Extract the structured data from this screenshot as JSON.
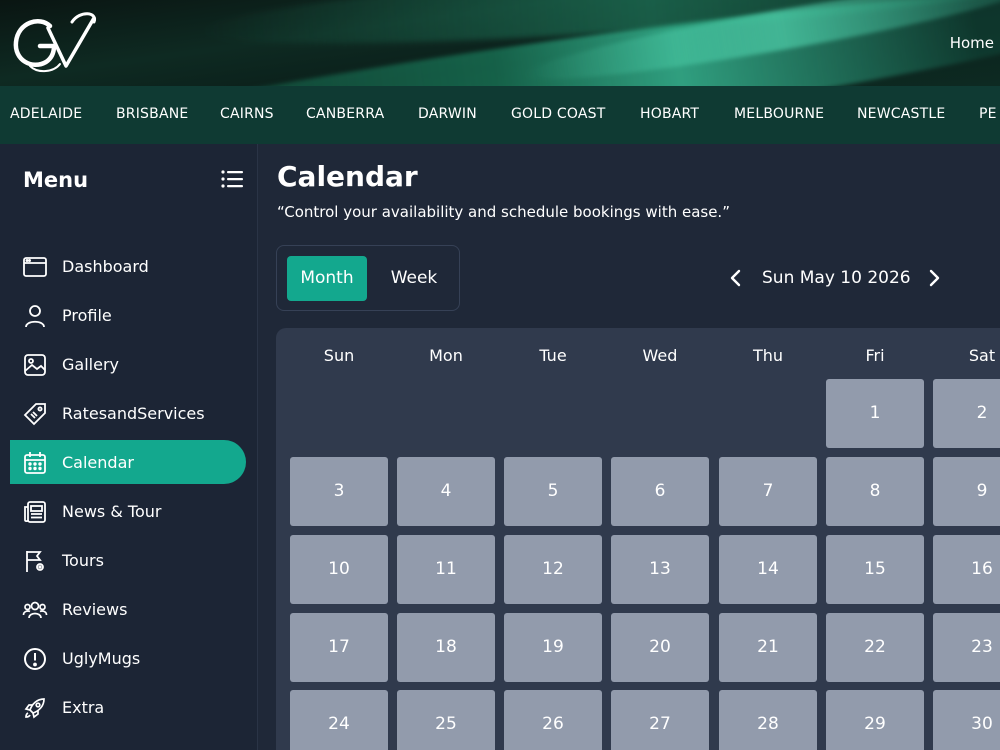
{
  "header": {
    "logo_text": "GV",
    "home_link": "Home"
  },
  "cities": [
    "ADELAIDE",
    "BRISBANE",
    "CAIRNS",
    "CANBERRA",
    "DARWIN",
    "GOLD COAST",
    "HOBART",
    "MELBOURNE",
    "NEWCASTLE",
    "PE"
  ],
  "sidebar": {
    "title": "Menu",
    "toggle_icon": "list-icon",
    "items": [
      {
        "label": "Dashboard",
        "icon": "dashboard-icon",
        "active": false
      },
      {
        "label": "Profile",
        "icon": "user-icon",
        "active": false
      },
      {
        "label": "Gallery",
        "icon": "image-icon",
        "active": false
      },
      {
        "label": "RatesandServices",
        "icon": "tag-icon",
        "active": false
      },
      {
        "label": "Calendar",
        "icon": "calendar-icon",
        "active": true
      },
      {
        "label": "News & Tour",
        "icon": "newspaper-icon",
        "active": false
      },
      {
        "label": "Tours",
        "icon": "flag-pin-icon",
        "active": false
      },
      {
        "label": "Reviews",
        "icon": "users-icon",
        "active": false
      },
      {
        "label": "UglyMugs",
        "icon": "alert-circle-icon",
        "active": false
      },
      {
        "label": "Extra",
        "icon": "rocket-icon",
        "active": false
      }
    ]
  },
  "main": {
    "title": "Calendar",
    "subtitle": "“Control your availability and schedule bookings with ease.”",
    "view_toggle": {
      "month": "Month",
      "week": "Week",
      "selected": "Month"
    },
    "date_label": "Sun May 10 2026",
    "weekdays": [
      "Sun",
      "Mon",
      "Tue",
      "Wed",
      "Thu",
      "Fri",
      "Sat"
    ],
    "first_weekday_index": 5,
    "days": [
      "1",
      "2",
      "3",
      "4",
      "5",
      "6",
      "7",
      "8",
      "9",
      "10",
      "11",
      "12",
      "13",
      "14",
      "15",
      "16",
      "17",
      "18",
      "19",
      "20",
      "21",
      "22",
      "23",
      "24",
      "25",
      "26",
      "27",
      "28",
      "29",
      "30"
    ]
  },
  "colors": {
    "accent": "#13a88e",
    "page_bg": "#1f2838",
    "sidebar_bg": "#1c2535",
    "cities_bar_bg": "#0f3a33",
    "calendar_bg": "#303a4d",
    "day_cell": "#929bac"
  }
}
